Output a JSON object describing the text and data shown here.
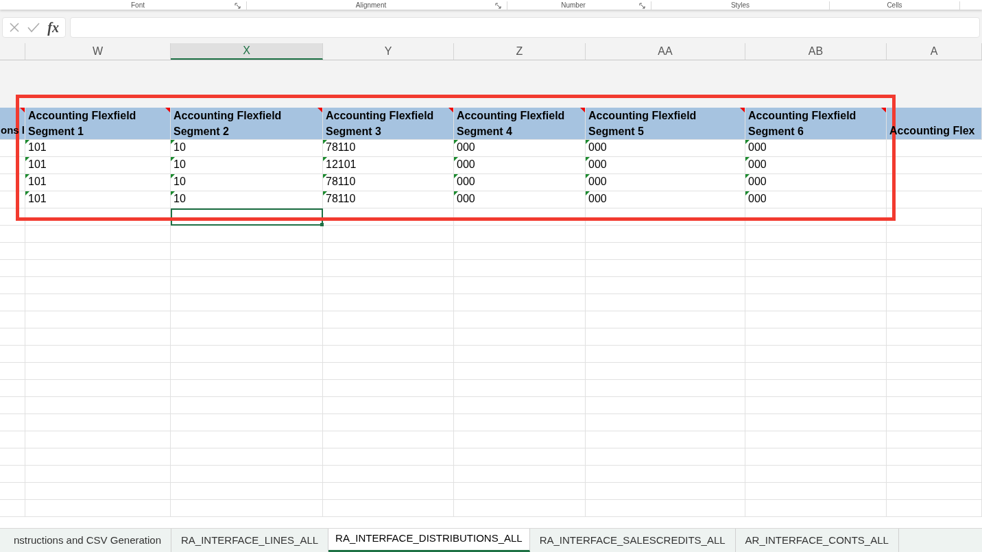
{
  "ribbon_groups": [
    {
      "label": "Font",
      "launcher": true
    },
    {
      "label": "Alignment",
      "launcher": true
    },
    {
      "label": "Number",
      "launcher": true
    },
    {
      "label": "Styles",
      "launcher": false
    },
    {
      "label": "Cells",
      "launcher": false
    }
  ],
  "formula_bar": {
    "fx": "fx"
  },
  "columns": [
    {
      "letter": "W",
      "selected": false
    },
    {
      "letter": "X",
      "selected": true
    },
    {
      "letter": "Y",
      "selected": false
    },
    {
      "letter": "Z",
      "selected": false
    },
    {
      "letter": "AA",
      "selected": false
    },
    {
      "letter": "AB",
      "selected": false
    },
    {
      "letter": "A",
      "selected": false
    }
  ],
  "header_row": {
    "lead": "ons l",
    "cells": [
      {
        "text": "Accounting Flexfield Segment 1",
        "comment": true
      },
      {
        "text": "Accounting Flexfield Segment 2",
        "comment": true
      },
      {
        "text": "Accounting Flexfield Segment 3",
        "comment": true
      },
      {
        "text": "Accounting Flexfield Segment 4",
        "comment": true
      },
      {
        "text": "Accounting Flexfield Segment 5",
        "comment": true
      },
      {
        "text": "Accounting Flexfield Segment 6",
        "comment": true
      },
      {
        "text": "Accounting Flex",
        "comment": false
      }
    ]
  },
  "rows": [
    [
      "101",
      "10",
      "78110",
      "000",
      "000",
      "000"
    ],
    [
      "101",
      "10",
      "12101",
      "000",
      "000",
      "000"
    ],
    [
      "101",
      "10",
      "78110",
      "000",
      "000",
      "000"
    ],
    [
      "101",
      "10",
      "78110",
      "000",
      "000",
      "000"
    ]
  ],
  "sheet_tabs": [
    {
      "label": "nstructions and CSV Generation",
      "selected": false
    },
    {
      "label": "RA_INTERFACE_LINES_ALL",
      "selected": false
    },
    {
      "label": "RA_INTERFACE_DISTRIBUTIONS_ALL",
      "selected": true
    },
    {
      "label": "RA_INTERFACE_SALESCREDITS_ALL",
      "selected": false
    },
    {
      "label": "AR_INTERFACE_CONTS_ALL",
      "selected": false
    }
  ]
}
